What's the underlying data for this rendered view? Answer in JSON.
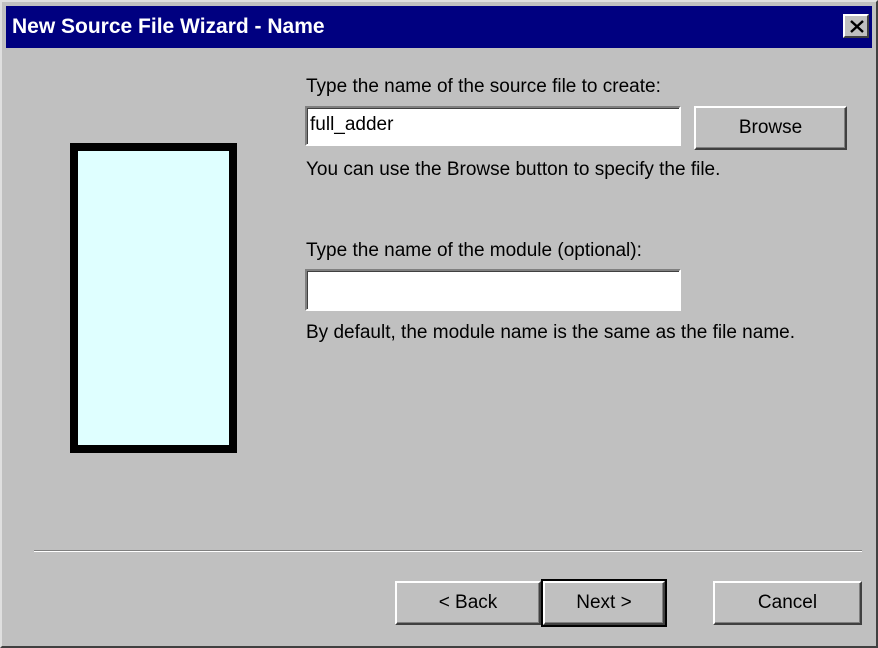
{
  "window": {
    "title": "New Source File Wizard - Name",
    "close_icon": "close-icon"
  },
  "colors": {
    "titlebar": "#000080",
    "face": "#c0c0c0",
    "graphic_fill": "#dfffff",
    "graphic_border": "#000000"
  },
  "file": {
    "label": "Type the name of the source file to create:",
    "value": "full_adder",
    "browse_label": "Browse",
    "hint": "You can use the Browse button to specify the file."
  },
  "module": {
    "label": "Type the name of the module (optional):",
    "value": "",
    "hint": "By default, the module name is the same as the file name."
  },
  "footer": {
    "back_label": "< Back",
    "next_label": "Next >",
    "cancel_label": "Cancel"
  }
}
